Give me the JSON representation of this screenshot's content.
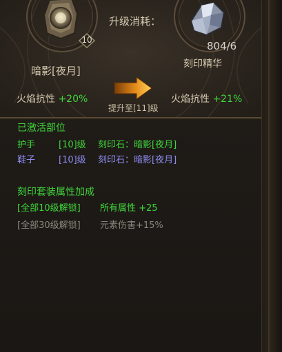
{
  "colors": {
    "active_green": "#3fd63a",
    "secondary_blue": "#8c8cf0",
    "locked_gray": "#8a857c",
    "gold_text": "#d8cbb2"
  },
  "header": {
    "cost_label": "升级消耗：",
    "item": {
      "name": "暗影[夜月]",
      "level": "10",
      "icon": "engraving-stone-icon"
    },
    "material": {
      "name": "刻印精华",
      "count": "804/6",
      "icon": "crystal-essence-icon"
    }
  },
  "upgrade": {
    "stat_before_label": "火焰抗性",
    "stat_before_value": "+20%",
    "stat_after_label": "火焰抗性",
    "stat_after_value": "+21%",
    "caption": "提升至[11]级",
    "arrow_icon": "arrow-right-icon"
  },
  "activated": {
    "title": "已激活部位",
    "parts": [
      {
        "slot": "护手",
        "level": "[10]级",
        "stone": "刻印石：暗影[夜月]"
      },
      {
        "slot": "鞋子",
        "level": "[10]级",
        "stone": "刻印石：暗影[夜月]"
      }
    ]
  },
  "set_bonus": {
    "title": "刻印套装属性加成",
    "tiers": [
      {
        "condition": "[全部10级解锁]",
        "effect": "所有属性 +25"
      },
      {
        "condition": "[全部30级解锁]",
        "effect": "元素伤害+15%"
      }
    ]
  }
}
